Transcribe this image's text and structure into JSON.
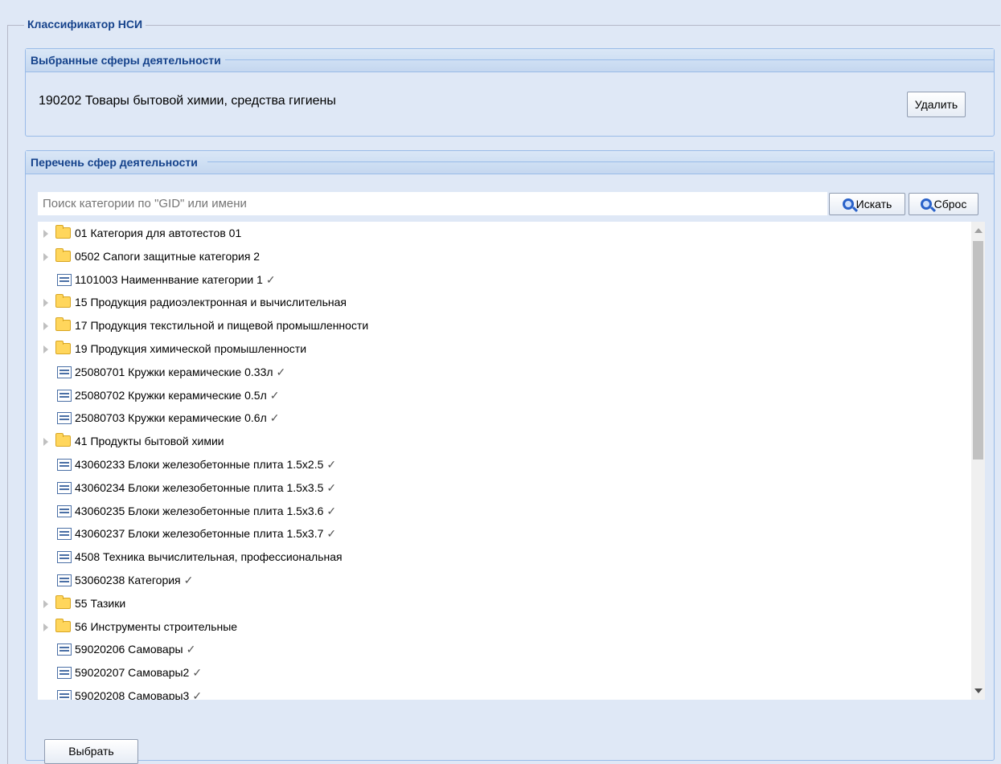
{
  "classifier": {
    "legend": "Классификатор НСИ"
  },
  "selected_panel": {
    "title": "Выбранные сферы деятельности",
    "item": "190202 Товары бытовой химии, средства гигиены",
    "delete_label": "Удалить"
  },
  "list_panel": {
    "title": "Перечень сфер деятельности",
    "search_placeholder": "Поиск категории по \"GID\" или имени",
    "search_label": "Искать",
    "reset_label": "Сброс",
    "select_label": "Выбрать",
    "items": [
      {
        "type": "folder",
        "label": "01 Категория для автотестов 01",
        "check": ""
      },
      {
        "type": "folder",
        "label": "0502 Сапоги защитные категория 2",
        "check": ""
      },
      {
        "type": "leaf",
        "label": "1101003 Наименнвание категории 1",
        "check": "✓"
      },
      {
        "type": "folder",
        "label": "15 Продукция радиоэлектронная и вычислительная",
        "check": ""
      },
      {
        "type": "folder",
        "label": "17 Продукция текстильной и пищевой промышленности",
        "check": ""
      },
      {
        "type": "folder",
        "label": "19 Продукция химической промышленности",
        "check": ""
      },
      {
        "type": "leaf",
        "label": "25080701 Кружки керамические 0.33л",
        "check": "✓"
      },
      {
        "type": "leaf",
        "label": "25080702 Кружки керамические 0.5л",
        "check": "✓"
      },
      {
        "type": "leaf",
        "label": "25080703 Кружки керамические 0.6л",
        "check": "✓"
      },
      {
        "type": "folder",
        "label": "41 Продукты бытовой химии",
        "check": ""
      },
      {
        "type": "leaf",
        "label": "43060233 Блоки железобетонные плита 1.5x2.5",
        "check": "✓"
      },
      {
        "type": "leaf",
        "label": "43060234 Блоки железобетонные плита 1.5x3.5",
        "check": "✓"
      },
      {
        "type": "leaf",
        "label": "43060235 Блоки железобетонные плита 1.5x3.6",
        "check": "✓"
      },
      {
        "type": "leaf",
        "label": "43060237 Блоки железобетонные плита 1.5x3.7",
        "check": "✓"
      },
      {
        "type": "leaf",
        "label": "4508 Техника вычислительная, профессиональная",
        "check": ""
      },
      {
        "type": "leaf",
        "label": "53060238 Категория",
        "check": "✓"
      },
      {
        "type": "folder",
        "label": "55 Тазики",
        "check": ""
      },
      {
        "type": "folder",
        "label": "56 Инструменты строительные",
        "check": ""
      },
      {
        "type": "leaf",
        "label": "59020206 Самовары",
        "check": "✓"
      },
      {
        "type": "leaf",
        "label": "59020207 Самовары2",
        "check": "✓"
      },
      {
        "type": "leaf",
        "label": "59020208 Самовары3",
        "check": "✓"
      }
    ]
  }
}
